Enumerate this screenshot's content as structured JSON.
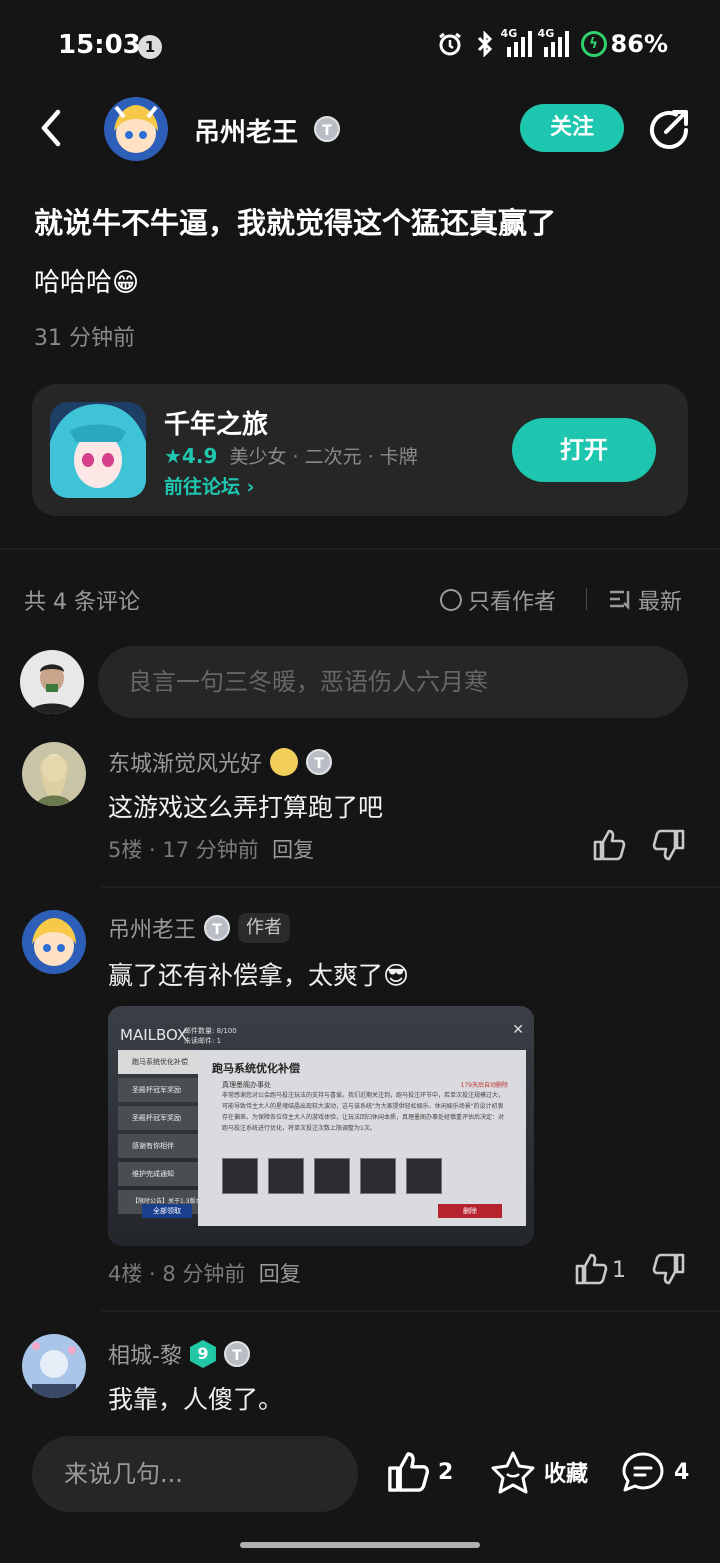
{
  "status": {
    "time": "15:03",
    "notif_count": "1",
    "battery": "86%",
    "net1": "4G",
    "net2": "4G"
  },
  "header": {
    "author": "吊州老王",
    "badge": "T",
    "follow_label": "关注"
  },
  "post": {
    "title": "就说牛不牛逼，我就觉得这个猛还真赢了",
    "body": "哈哈哈😁",
    "time": "31 分钟前"
  },
  "game": {
    "name": "千年之旅",
    "rating": "★4.9",
    "tags": "美少女 · 二次元 · 卡牌",
    "link": "前往论坛 ›",
    "open_label": "打开"
  },
  "comments_header": {
    "count": "共 4 条评论",
    "only_author": "只看作者",
    "sort": "最新"
  },
  "comment_input": {
    "placeholder": "良言一句三冬暖，恶语伤人六月寒"
  },
  "comments": [
    {
      "name": "东城渐觉风光好",
      "text": "这游戏这么弄打算跑了吧",
      "meta": "5楼 · 17 分钟前",
      "reply": "回复",
      "likes": ""
    },
    {
      "name": "吊州老王",
      "author_tag": "作者",
      "text": "赢了还有补偿拿，太爽了😎",
      "meta": "4楼 · 8 分钟前",
      "reply": "回复",
      "likes": "1"
    },
    {
      "name": "相城-黎",
      "level": "9",
      "text": "我靠，人傻了。"
    }
  ],
  "screenshot": {
    "mailbox": "MAILBOX",
    "mail_count": "邮件数量: 8/100",
    "unread": "未读邮件: 1",
    "title": "跑马系统优化补偿",
    "sender": "真理墨阁办事处",
    "expire": "179天后自动删除",
    "body": "非常感谢您对公会跑马投注玩法的支持与喜爱。我们近期关注到，跑马投注环节中，若单次投注规模过大，可能导致侍主大人的星魂结晶出现较大波动，这与该系统\"为大家提供轻松娱乐、休闲娱乐场景\"的设计初衷存在偏差。为保障各位侍主大人的游戏体验，让玩法回归休闲本质，真理墨阁办事处经慎重评估后决定：对跑马投注系统进行优化，将单次投注次数上限调整为1次。",
    "list": [
      "跑马系统优化补偿",
      "圣殿杯冠军奖励",
      "圣殿杯冠军奖励",
      "感谢有你相伴",
      "维护完成通知",
      "【限时公告】关于1.3版本"
    ],
    "claim_all": "全部领取",
    "delete": "删除"
  },
  "bottom": {
    "say_placeholder": "来说几句...",
    "likes": "2",
    "favorite": "收藏",
    "comments": "4"
  }
}
